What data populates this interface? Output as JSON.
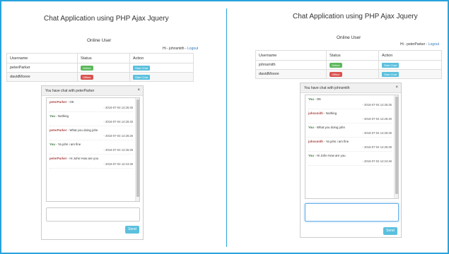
{
  "colors": {
    "frame": "#27a3dd",
    "online": "#5cb85c",
    "offline": "#d9534f",
    "info": "#5bc0de",
    "link": "#337ab7",
    "me": "#3c763d",
    "them": "#a94442"
  },
  "left": {
    "title": "Chat Application using PHP Ajax Jquery",
    "online_heading": "Online User",
    "greeting": "Hi - johnsmith - ",
    "logout": "Logout",
    "table": {
      "headers": [
        "Username",
        "Status",
        "Action"
      ],
      "rows": [
        {
          "username": "peterParker",
          "status": "Online",
          "action": "Start Chat"
        },
        {
          "username": "davidMoore",
          "status": "Offline",
          "action": "Start Chat"
        }
      ]
    },
    "chat": {
      "header": "You have chat with peterParker",
      "close": "×",
      "messages": [
        {
          "who": "peterParker",
          "text": " - OK",
          "time": "- 2016-07-04 14:26:45"
        },
        {
          "who": "You",
          "text": " - Nothing",
          "time": "- 2016-07-04 14:26:40"
        },
        {
          "who": "peterParker",
          "text": " - What you doing john",
          "time": "- 2016-07-04 14:26:26"
        },
        {
          "who": "You",
          "text": " - Ya john i am fine",
          "time": "- 2016-07-04 14:25:29"
        },
        {
          "who": "peterParker",
          "text": " - Hi John How are you",
          "time": "- 2016-07-04 14:24:46"
        }
      ],
      "send": "Send"
    }
  },
  "right": {
    "title": "Chat Application using PHP Ajax Jquery",
    "online_heading": "Online User",
    "greeting": "Hi - peterParker - ",
    "logout": "Logout",
    "table": {
      "headers": [
        "Username",
        "Status",
        "Action"
      ],
      "rows": [
        {
          "username": "johnsmith",
          "status": "Online",
          "action": "Start Chat"
        },
        {
          "username": "davidMoore",
          "status": "Offline",
          "action": "Start Chat"
        }
      ]
    },
    "chat": {
      "header": "You have chat with johnsmith",
      "close": "×",
      "messages": [
        {
          "who": "You",
          "text": " - OK",
          "time": "- 2016-07-04 14:26:45"
        },
        {
          "who": "johnsmith",
          "text": " - Nothing",
          "time": "- 2016-07-04 14:26:40"
        },
        {
          "who": "You",
          "text": " - What you doing john",
          "time": "- 2016-07-04 14:26:26"
        },
        {
          "who": "johnsmith",
          "text": " - Ya john i am fine",
          "time": "- 2016-07-04 14:25:29"
        },
        {
          "who": "You",
          "text": " - Hi John How are you",
          "time": "- 2016-07-04 14:24:46"
        }
      ],
      "send": "Send"
    }
  }
}
